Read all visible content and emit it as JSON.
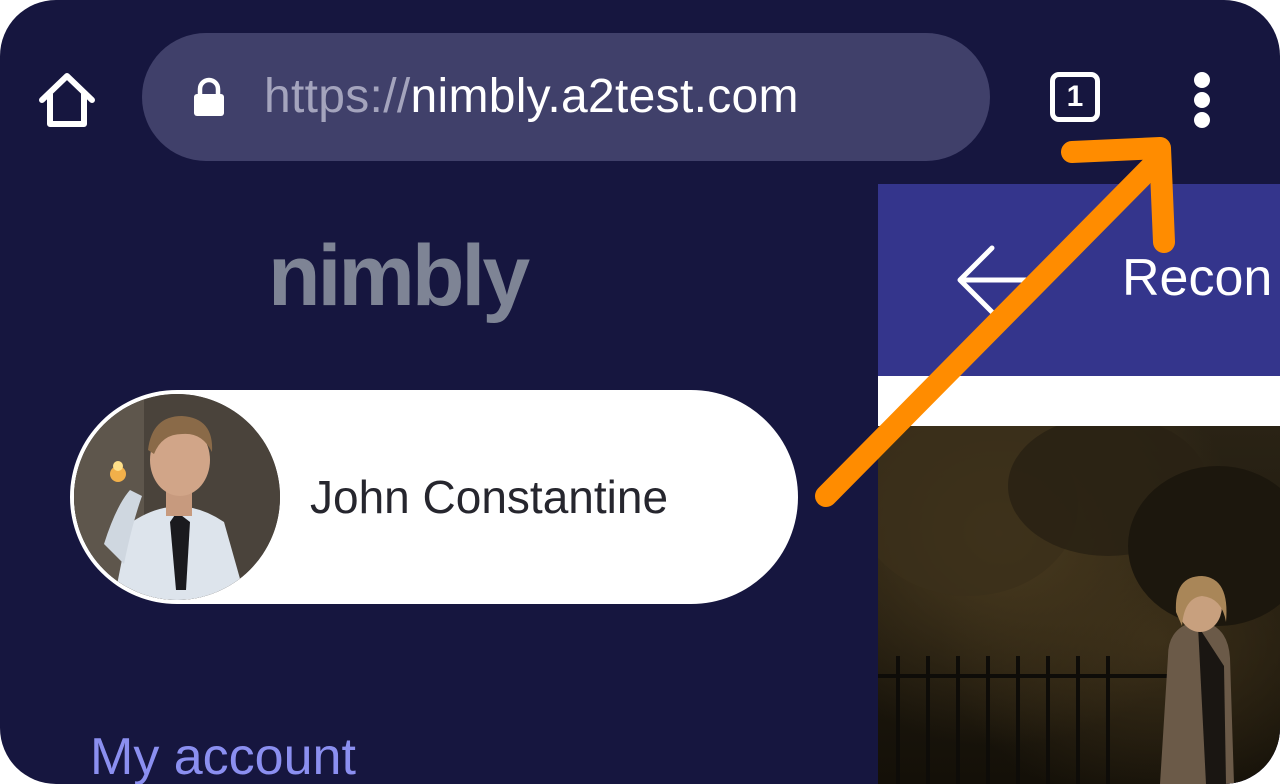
{
  "browser": {
    "url_scheme": "https://",
    "url_host": "nimbly.a2test.com",
    "tab_count": "1",
    "icons": {
      "home": "home-icon",
      "lock": "lock-icon",
      "tabs": "tab-switcher-icon",
      "menu": "more-vert-icon"
    }
  },
  "sidebar": {
    "logo_text": "nimbly",
    "profile": {
      "name": "John Constantine",
      "avatar": "avatar-photo"
    },
    "menu_items": [
      {
        "label": "My account"
      }
    ]
  },
  "right_panel": {
    "title": "Recon",
    "icons": {
      "back": "arrow-back-icon"
    }
  },
  "annotation": {
    "color": "#ff8c00",
    "icon": "pointer-arrow"
  },
  "colors": {
    "background": "#16163f",
    "url_bar": "#40406a",
    "accent_link": "#8b8ff0",
    "header": "#34358c"
  }
}
